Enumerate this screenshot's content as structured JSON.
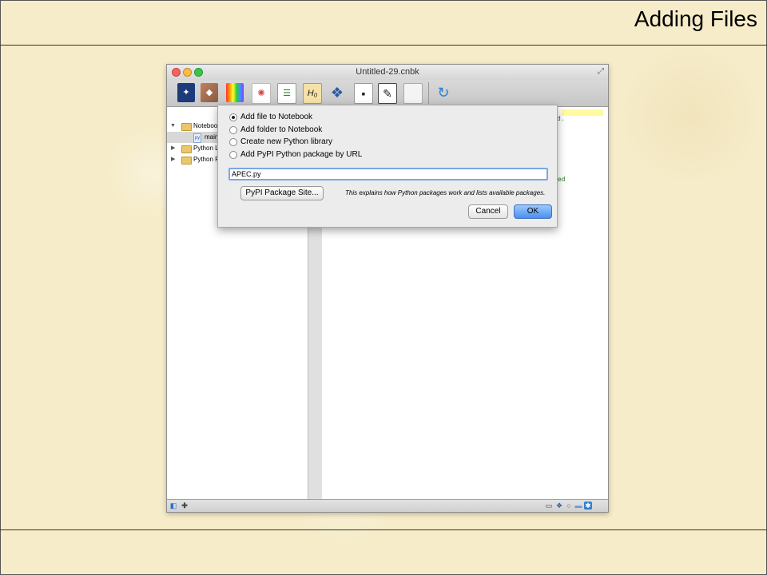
{
  "slide": {
    "title": "Adding Files"
  },
  "window": {
    "title": "Untitled-29.cnbk",
    "toolbar_icons": [
      "telescope-icon",
      "tag-icon",
      "spectrum-icon",
      "color-wheel-icon",
      "table-icon",
      "heading-icon",
      "python-icon",
      "black-square-icon",
      "notepad-icon",
      "page-icon",
      "refresh-icon"
    ],
    "heading_label": "H₀"
  },
  "sidebar": {
    "items": [
      {
        "label": "Notebook",
        "type": "folder",
        "expanded": true
      },
      {
        "label": "main",
        "type": "file"
      },
      {
        "label": "Python Li",
        "type": "folder",
        "expanded": false
      },
      {
        "label": "Python P",
        "type": "folder",
        "expanded": false
      }
    ]
  },
  "editor": {
    "fragments": [
      "d.",
      "ted"
    ]
  },
  "dialog": {
    "options": [
      {
        "label": "Add file to Notebook",
        "selected": true
      },
      {
        "label": "Add folder to Notebook",
        "selected": false
      },
      {
        "label": "Create new Python library",
        "selected": false
      },
      {
        "label": "Add PyPI Python package by URL",
        "selected": false
      }
    ],
    "path_value": "APEC.py",
    "pypi_button": "PyPI Package Site...",
    "explanation": "This explains how Python packages work and lists available packages.",
    "cancel_button": "Cancel",
    "ok_button": "OK"
  },
  "colors": {
    "slide_background": "#f6ecc9",
    "default_button": "#4a8ff0",
    "input_focus": "#7aa7e8"
  }
}
